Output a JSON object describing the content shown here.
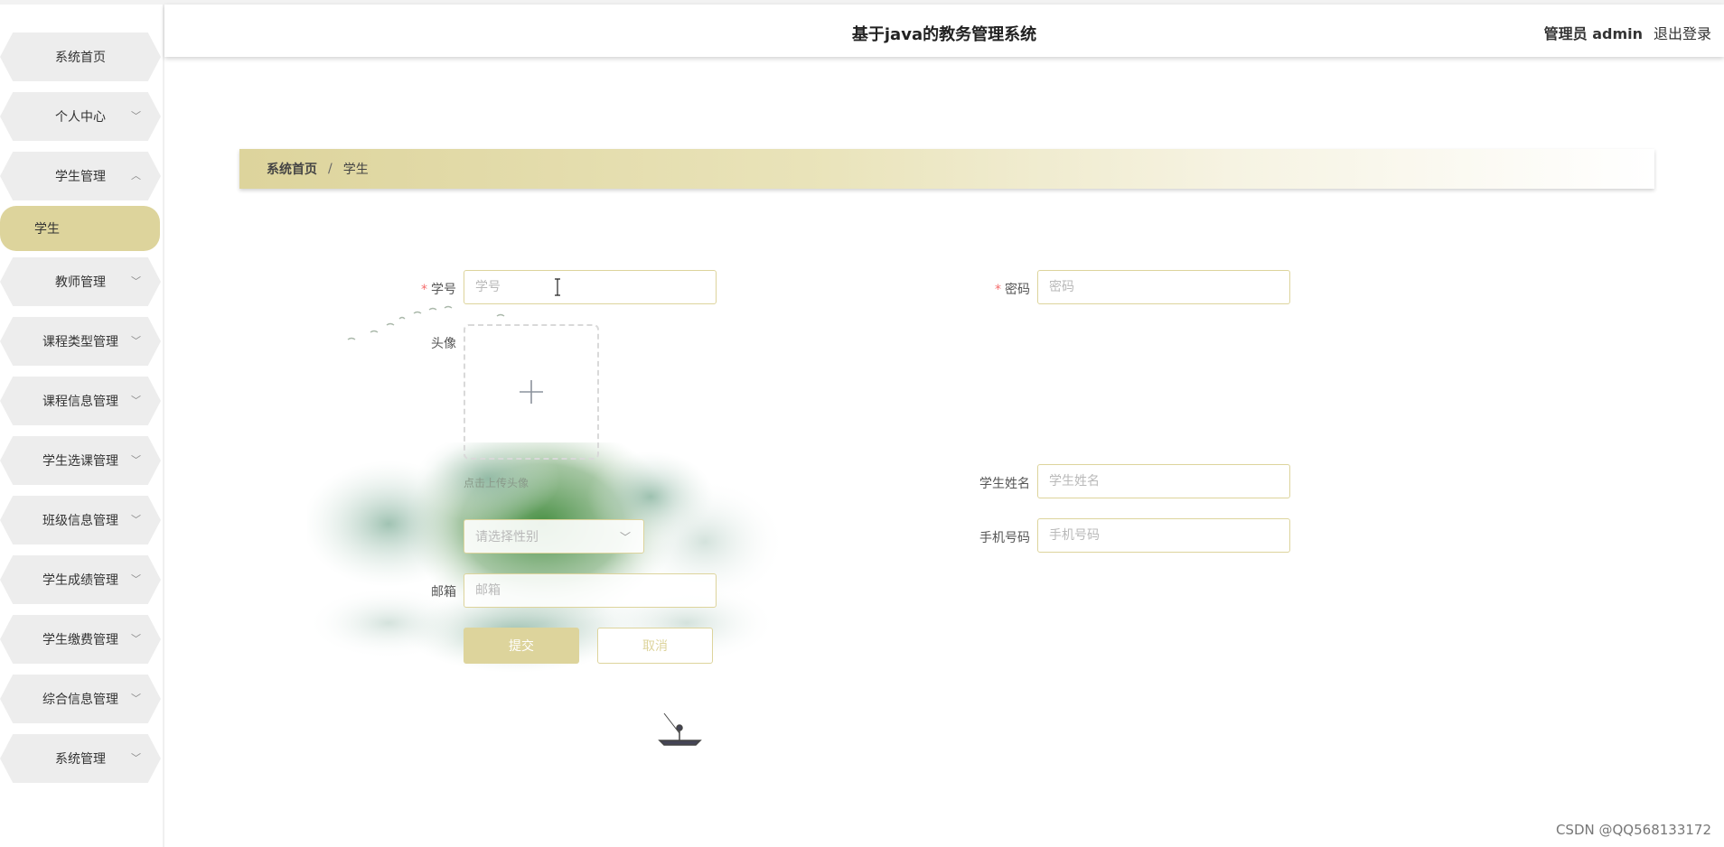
{
  "header": {
    "title": "基于java的教务管理系统",
    "user": "管理员 admin",
    "logout": "退出登录"
  },
  "sidebar": {
    "items": [
      {
        "label": "系统首页",
        "has_children": false
      },
      {
        "label": "个人中心",
        "has_children": true,
        "expanded": false
      },
      {
        "label": "学生管理",
        "has_children": true,
        "expanded": true
      },
      {
        "label": "教师管理",
        "has_children": true,
        "expanded": false
      },
      {
        "label": "课程类型管理",
        "has_children": true,
        "expanded": false
      },
      {
        "label": "课程信息管理",
        "has_children": true,
        "expanded": false
      },
      {
        "label": "学生选课管理",
        "has_children": true,
        "expanded": false
      },
      {
        "label": "班级信息管理",
        "has_children": true,
        "expanded": false
      },
      {
        "label": "学生成绩管理",
        "has_children": true,
        "expanded": false
      },
      {
        "label": "学生缴费管理",
        "has_children": true,
        "expanded": false
      },
      {
        "label": "综合信息管理",
        "has_children": true,
        "expanded": false
      },
      {
        "label": "系统管理",
        "has_children": true,
        "expanded": false
      }
    ],
    "active_sub": "学生"
  },
  "breadcrumb": {
    "home": "系统首页",
    "separator": "/",
    "current": "学生"
  },
  "form": {
    "student_id": {
      "label": "学号",
      "required": true,
      "placeholder": "学号",
      "value": ""
    },
    "password": {
      "label": "密码",
      "required": true,
      "placeholder": "密码",
      "value": ""
    },
    "avatar": {
      "label": "头像",
      "hint": "点击上传头像"
    },
    "name": {
      "label": "学生姓名",
      "placeholder": "学生姓名",
      "value": ""
    },
    "gender": {
      "placeholder": "请选择性别"
    },
    "phone": {
      "label": "手机号码",
      "placeholder": "手机号码",
      "value": ""
    },
    "email": {
      "label": "邮箱",
      "placeholder": "邮箱",
      "value": ""
    },
    "submit": "提交",
    "cancel": "取消"
  },
  "icons": {
    "chevron_down": "chevron-down-icon",
    "chevron_up": "chevron-up-icon",
    "plus": "plus-icon"
  },
  "colors": {
    "accent": "#ddd49c",
    "required": "#f56c6c"
  },
  "watermark": "CSDN @QQ568133172"
}
